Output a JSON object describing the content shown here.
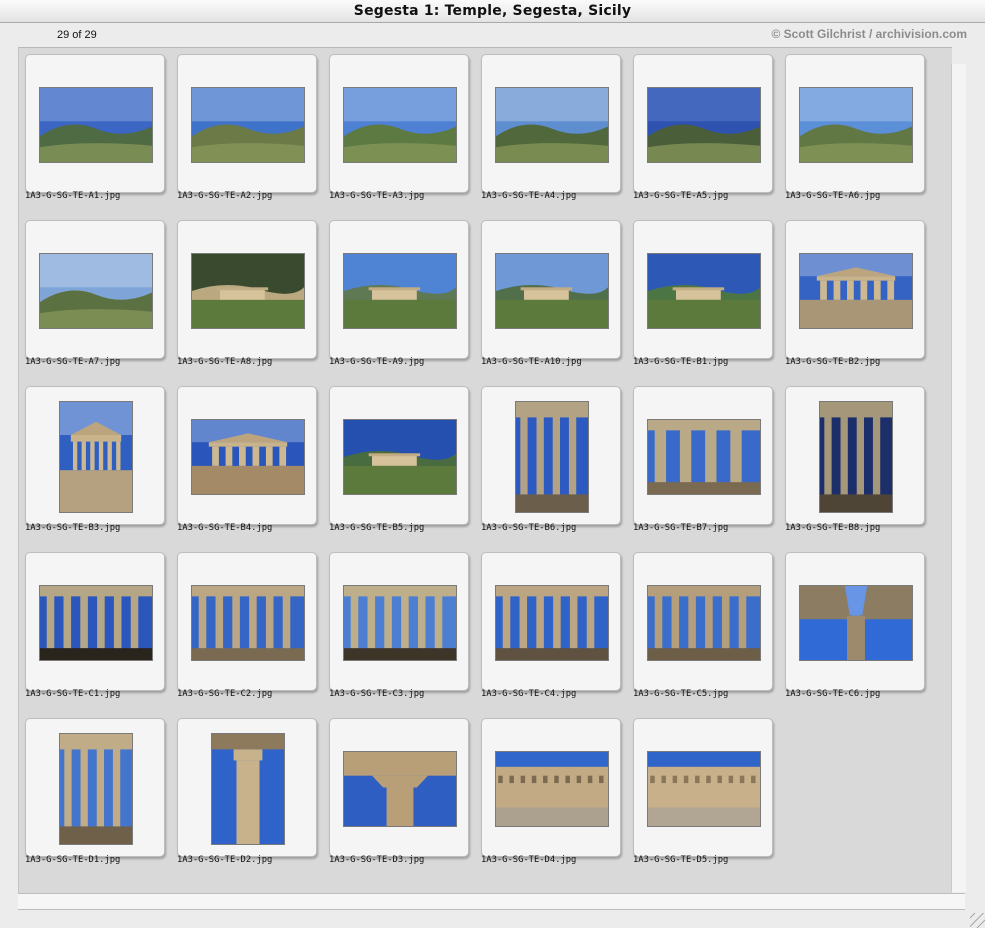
{
  "window": {
    "title": "Segesta 1: Temple, Segesta, Sicily"
  },
  "header": {
    "count": "29 of 29",
    "copyright": "© Scott Gilchrist / archivision.com"
  },
  "thumbnails": [
    {
      "file": "1A3-G-SG-TE-A1.jpg",
      "orientation": "landscape",
      "scene": "landscape",
      "colors": [
        "#3b66c4",
        "#aec6ea",
        "#4f6b43"
      ]
    },
    {
      "file": "1A3-G-SG-TE-A2.jpg",
      "orientation": "landscape",
      "scene": "landscape",
      "colors": [
        "#3f72c9",
        "#c8d9ef",
        "#6c7a48"
      ]
    },
    {
      "file": "1A3-G-SG-TE-A3.jpg",
      "orientation": "landscape",
      "scene": "landscape",
      "colors": [
        "#4e80d3",
        "#c9daf1",
        "#5d7a43"
      ]
    },
    {
      "file": "1A3-G-SG-TE-A4.jpg",
      "orientation": "landscape",
      "scene": "landscape",
      "colors": [
        "#5e8ecf",
        "#d7e3f3",
        "#50683b"
      ]
    },
    {
      "file": "1A3-G-SG-TE-A5.jpg",
      "orientation": "landscape",
      "scene": "landscape",
      "colors": [
        "#2d52b0",
        "#6f93d6",
        "#4b5e3a"
      ]
    },
    {
      "file": "1A3-G-SG-TE-A6.jpg",
      "orientation": "landscape",
      "scene": "landscape",
      "colors": [
        "#5b8fd8",
        "#cfdff4",
        "#617845"
      ]
    },
    {
      "file": "1A3-G-SG-TE-A7.jpg",
      "orientation": "landscape",
      "scene": "landscape",
      "colors": [
        "#7ea4d8",
        "#e0e9f4",
        "#5c7142"
      ]
    },
    {
      "file": "1A3-G-SG-TE-A8.jpg",
      "orientation": "landscape",
      "scene": "temple-far",
      "colors": [
        "#3a4a2e",
        "#7a8b4e",
        "#c9b48a"
      ]
    },
    {
      "file": "1A3-G-SG-TE-A9.jpg",
      "orientation": "landscape",
      "scene": "temple-far",
      "colors": [
        "#4f84d5",
        "#b9cde8",
        "#607846"
      ]
    },
    {
      "file": "1A3-G-SG-TE-A10.jpg",
      "orientation": "landscape",
      "scene": "temple-far",
      "colors": [
        "#6f98d6",
        "#cddcf0",
        "#4f6a3c"
      ]
    },
    {
      "file": "1A3-G-SG-TE-B1.jpg",
      "orientation": "landscape",
      "scene": "temple-far",
      "colors": [
        "#2e58b6",
        "#8eaee0",
        "#4f7a36"
      ]
    },
    {
      "file": "1A3-G-SG-TE-B2.jpg",
      "orientation": "landscape",
      "scene": "temple-near",
      "colors": [
        "#3563c3",
        "#a7bde3",
        "#a89677"
      ]
    },
    {
      "file": "1A3-G-SG-TE-B3.jpg",
      "orientation": "portrait",
      "scene": "temple-front",
      "colors": [
        "#2f5fc0",
        "#b2c7ea",
        "#b5a17f"
      ]
    },
    {
      "file": "1A3-G-SG-TE-B4.jpg",
      "orientation": "landscape",
      "scene": "temple-near",
      "colors": [
        "#2a56bb",
        "#9ab5e2",
        "#a48a66"
      ]
    },
    {
      "file": "1A3-G-SG-TE-B5.jpg",
      "orientation": "landscape",
      "scene": "temple-far",
      "colors": [
        "#2650b0",
        "#8aa7dc",
        "#4c6e33"
      ]
    },
    {
      "file": "1A3-G-SG-TE-B6.jpg",
      "orientation": "portrait",
      "scene": "columns",
      "colors": [
        "#2d5ac0",
        "#b3a384",
        "#6b5f4c"
      ]
    },
    {
      "file": "1A3-G-SG-TE-B7.jpg",
      "orientation": "landscape",
      "scene": "columns",
      "colors": [
        "#3a6ac9",
        "#b9a987",
        "#7a6a52"
      ]
    },
    {
      "file": "1A3-G-SG-TE-B8.jpg",
      "orientation": "portrait",
      "scene": "columns",
      "colors": [
        "#1c2f6a",
        "#a5977a",
        "#4f4536"
      ]
    },
    {
      "file": "1A3-G-SG-TE-C1.jpg",
      "orientation": "landscape",
      "scene": "colonnade",
      "colors": [
        "#2b57bc",
        "#b5a785",
        "#29241c"
      ]
    },
    {
      "file": "1A3-G-SG-TE-C2.jpg",
      "orientation": "landscape",
      "scene": "colonnade",
      "colors": [
        "#3566c6",
        "#bba783",
        "#7a6a52"
      ]
    },
    {
      "file": "1A3-G-SG-TE-C3.jpg",
      "orientation": "landscape",
      "scene": "colonnade",
      "colors": [
        "#4c7fd2",
        "#bfae8a",
        "#3d3628"
      ]
    },
    {
      "file": "1A3-G-SG-TE-C4.jpg",
      "orientation": "landscape",
      "scene": "colonnade",
      "colors": [
        "#2f63c7",
        "#bba582",
        "#5f5240"
      ]
    },
    {
      "file": "1A3-G-SG-TE-C5.jpg",
      "orientation": "landscape",
      "scene": "colonnade",
      "colors": [
        "#3b6ecb",
        "#b59e7b",
        "#6d5e47"
      ]
    },
    {
      "file": "1A3-G-SG-TE-C6.jpg",
      "orientation": "landscape",
      "scene": "sky-capital",
      "colors": [
        "#2f6ad6",
        "#8fb3ee",
        "#8c7c62"
      ]
    },
    {
      "file": "1A3-G-SG-TE-D1.jpg",
      "orientation": "portrait",
      "scene": "columns",
      "colors": [
        "#4475cc",
        "#c0ad88",
        "#6f604a"
      ]
    },
    {
      "file": "1A3-G-SG-TE-D2.jpg",
      "orientation": "portrait",
      "scene": "single-column",
      "colors": [
        "#2f63c9",
        "#c7b28c",
        "#8d7a5c"
      ]
    },
    {
      "file": "1A3-G-SG-TE-D3.jpg",
      "orientation": "landscape",
      "scene": "capital",
      "colors": [
        "#2f5ec2",
        "#b89f78",
        "#6b5a42"
      ]
    },
    {
      "file": "1A3-G-SG-TE-D4.jpg",
      "orientation": "landscape",
      "scene": "entablature",
      "colors": [
        "#3067cb",
        "#c2aa84",
        "#7c6a50"
      ]
    },
    {
      "file": "1A3-G-SG-TE-D5.jpg",
      "orientation": "landscape",
      "scene": "entablature",
      "colors": [
        "#2f64c9",
        "#c8b08a",
        "#8a7658"
      ]
    }
  ]
}
